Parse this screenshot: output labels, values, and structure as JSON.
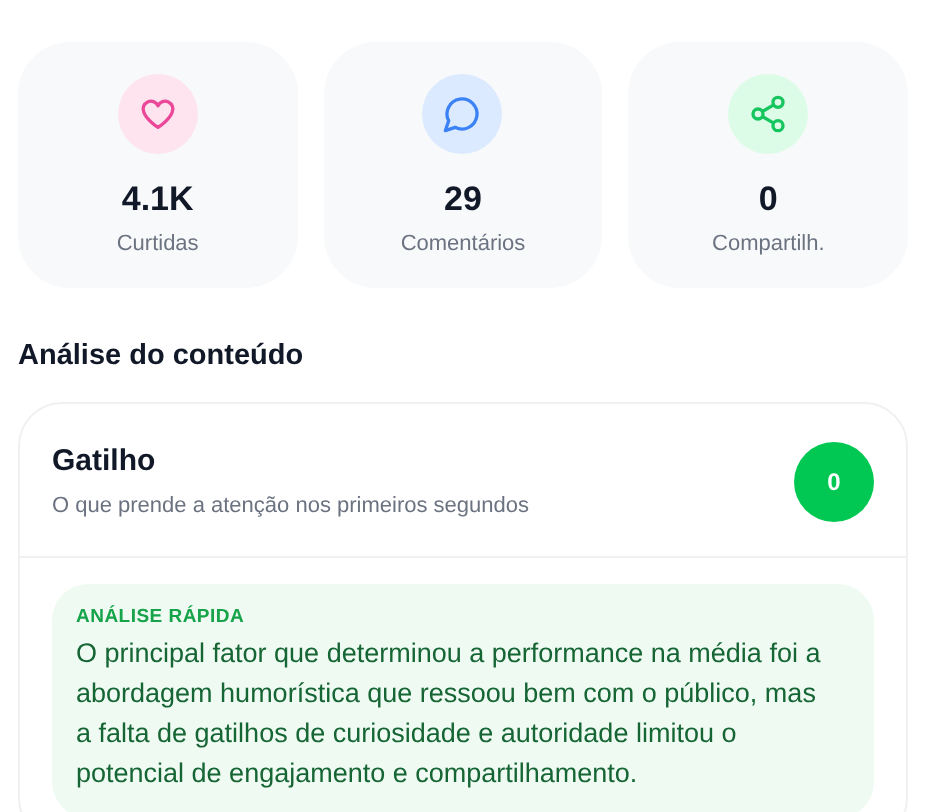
{
  "stats": [
    {
      "kind": "heart",
      "value": "4.1K",
      "label": "Curtidas"
    },
    {
      "kind": "chat",
      "value": "29",
      "label": "Comentários"
    },
    {
      "kind": "share",
      "value": "0",
      "label": "Compartilh."
    }
  ],
  "section_title": "Análise do conteúdo",
  "analysis_card": {
    "title": "Gatilho",
    "subtitle": "O que prende a atenção nos primeiros segundos",
    "score": "0",
    "quick_analysis": {
      "label": "ANÁLISE RÁPIDA",
      "text": "O principal fator que determinou a performance na média foi a abordagem humorística que ressoou bem com o público, mas a falta de gatilhos de curiosidade e autoridade limitou o potencial de engajamento e compartilhamento."
    }
  }
}
